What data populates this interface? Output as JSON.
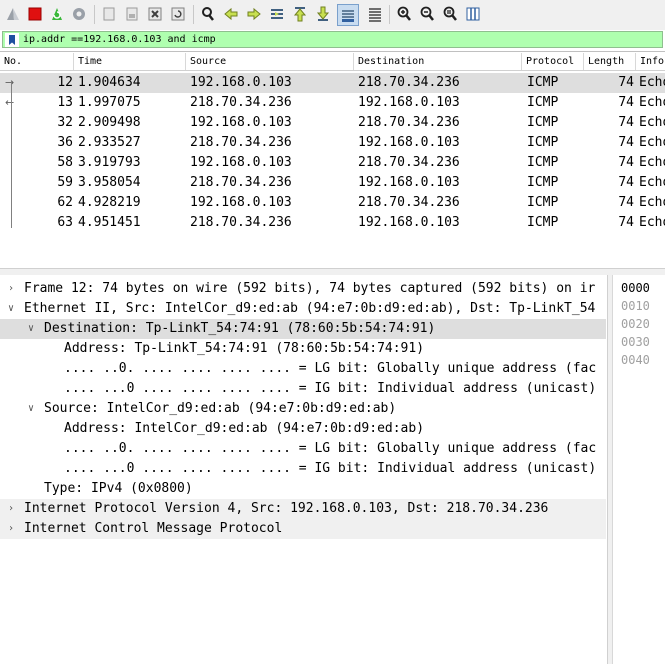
{
  "toolbar": {
    "icons": [
      "shark-fin-icon",
      "stop-icon",
      "restart-icon",
      "options-gear-icon",
      "open-file-icon",
      "save-file-icon",
      "close-file-icon",
      "reload-file-icon",
      "find-icon",
      "go-back-icon",
      "go-forward-icon",
      "go-to-packet-icon",
      "first-packet-icon",
      "last-packet-icon",
      "auto-scroll-icon",
      "colorize-icon",
      "zoom-in-icon",
      "zoom-out-icon",
      "zoom-normal-icon",
      "resize-columns-icon"
    ]
  },
  "filter": {
    "value": "ip.addr ==192.168.0.103 and icmp",
    "bg_color": "#afffaf"
  },
  "columns": [
    "No.",
    "Time",
    "Source",
    "Destination",
    "Protocol",
    "Length",
    "Info"
  ],
  "packets": [
    {
      "no": "12",
      "time": "1.904634",
      "src": "192.168.0.103",
      "dst": "218.70.34.236",
      "proto": "ICMP",
      "len": "74",
      "info": "Echo"
    },
    {
      "no": "13",
      "time": "1.997075",
      "src": "218.70.34.236",
      "dst": "192.168.0.103",
      "proto": "ICMP",
      "len": "74",
      "info": "Echo"
    },
    {
      "no": "32",
      "time": "2.909498",
      "src": "192.168.0.103",
      "dst": "218.70.34.236",
      "proto": "ICMP",
      "len": "74",
      "info": "Echo"
    },
    {
      "no": "36",
      "time": "2.933527",
      "src": "218.70.34.236",
      "dst": "192.168.0.103",
      "proto": "ICMP",
      "len": "74",
      "info": "Echo"
    },
    {
      "no": "58",
      "time": "3.919793",
      "src": "192.168.0.103",
      "dst": "218.70.34.236",
      "proto": "ICMP",
      "len": "74",
      "info": "Echo"
    },
    {
      "no": "59",
      "time": "3.958054",
      "src": "218.70.34.236",
      "dst": "192.168.0.103",
      "proto": "ICMP",
      "len": "74",
      "info": "Echo"
    },
    {
      "no": "62",
      "time": "4.928219",
      "src": "192.168.0.103",
      "dst": "218.70.34.236",
      "proto": "ICMP",
      "len": "74",
      "info": "Echo"
    },
    {
      "no": "63",
      "time": "4.951451",
      "src": "218.70.34.236",
      "dst": "192.168.0.103",
      "proto": "ICMP",
      "len": "74",
      "info": "Echo"
    }
  ],
  "details": [
    {
      "text": "Frame 12: 74 bytes on wire (592 bits), 74 bytes captured (592 bits) on ir",
      "expander": "collapsed"
    },
    {
      "text": "Ethernet II, Src: IntelCor_d9:ed:ab (94:e7:0b:d9:ed:ab), Dst: Tp-LinkT_54",
      "expander": "expanded"
    },
    {
      "text": "Destination: Tp-LinkT_54:74:91 (78:60:5b:54:74:91)",
      "expander": "expanded"
    },
    {
      "text": "Address: Tp-LinkT_54:74:91 (78:60:5b:54:74:91)",
      "expander": "none"
    },
    {
      "text": ".... ..0. .... .... .... .... = LG bit: Globally unique address (fac",
      "expander": "none"
    },
    {
      "text": ".... ...0 .... .... .... .... = IG bit: Individual address (unicast)",
      "expander": "none"
    },
    {
      "text": "Source: IntelCor_d9:ed:ab (94:e7:0b:d9:ed:ab)",
      "expander": "expanded"
    },
    {
      "text": "Address: IntelCor_d9:ed:ab (94:e7:0b:d9:ed:ab)",
      "expander": "none"
    },
    {
      "text": ".... ..0. .... .... .... .... = LG bit: Globally unique address (fac",
      "expander": "none"
    },
    {
      "text": ".... ...0 .... .... .... .... = IG bit: Individual address (unicast)",
      "expander": "none"
    },
    {
      "text": "Type: IPv4 (0x0800)",
      "expander": "none"
    },
    {
      "text": "Internet Protocol Version 4, Src: 192.168.0.103, Dst: 218.70.34.236",
      "expander": "collapsed"
    },
    {
      "text": "Internet Control Message Protocol",
      "expander": "collapsed"
    }
  ],
  "bytes_offsets": [
    "0000",
    "0010",
    "0020",
    "0030",
    "0040"
  ]
}
